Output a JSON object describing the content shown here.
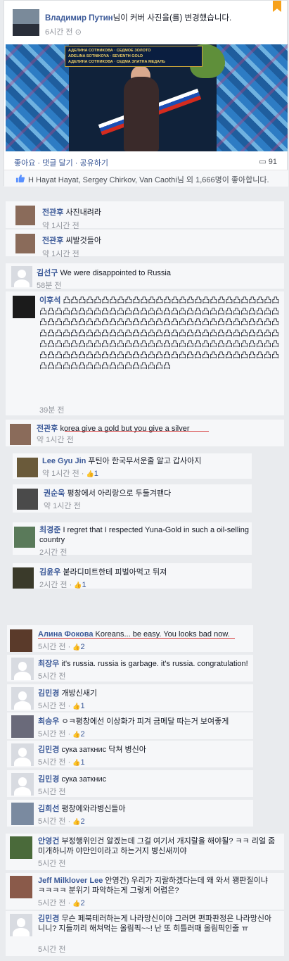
{
  "post": {
    "author": "Владимир Путин",
    "action_text": "님이 커버 사진을(를) 변경했습니다.",
    "time": "6시간 전",
    "photo_banner": [
      "АДЕЛИНА СОТНИКОВА · СЕДМОЕ ЗОЛОТО",
      "ADELINA SOTNIKOVA · SEVENTH GOLD",
      "АДЕЛИНА СОТНИКОВА · СЕДМА ЗЛАТНА МЕДАЛЬ"
    ],
    "actions": [
      "좋아요",
      "댓글 달기",
      "공유하기"
    ],
    "comment_count": "91",
    "likes_text": "H Hayat Hayat, Sergey Chirkov, Van Caothi님 외 1,666명이 좋아합니다."
  },
  "comments": [
    {
      "name": "전관후",
      "text": "사진내려라",
      "time": "약 1시간 전"
    },
    {
      "name": "전관후",
      "text": "씨발것들아",
      "time": "약 1시간 전"
    },
    {
      "name": "김선구",
      "text": "We were disappointed to Russia",
      "time": "58분 전"
    },
    {
      "name": "이후석",
      "text": "凸凸凸凸凸凸凸凸凸凸凸凸凸凸凸凸凸凸凸凸凸凸凸凸凸凸凸凸凸凸凸凸凸凸凸凸凸凸凸凸凸凸凸凸凸凸凸凸凸凸凸凸凸凸凸凸凸凸凸凸凸凸凸凸凸凸凸凸凸凸凸凸凸凸凸凸凸凸凸凸凸凸凸凸凸凸凸凸凸凸凸凸凸凸凸凸凸凸凸凸凸凸凸凸凸凸凸凸凸凸凸凸凸凸凸凸凸凸凸凸凸凸凸凸凸凸凸凸凸凸凸凸凸凸凸凸凸凸凸凸凸凸凸凸凸凸凸凸凸凸凸凸凸凸凸凸凸凸凸凸凸凸凸凸凸凸凸凸凸凸凸凸凸凸凸凸凸凸凸凸凸凸凸凸凸凸凸凸凸凸凸凸凸凸凸凸凸凸凸凸",
      "time": "39분 전"
    },
    {
      "name": "전관후",
      "text": "korea give a gold but you give a silver",
      "time": "약 1시간 전"
    },
    {
      "name": "Lee Gyu Jin",
      "text": "푸틴아 한국무서운줄 알고 갑사아지",
      "time": "약 1시간 전",
      "likes": "1"
    },
    {
      "name": "권순욱",
      "text": "평창에서 아리랑으로 두둘겨팬다",
      "time": "약 1시간 전"
    },
    {
      "name": "최경준",
      "text": "I regret that I respected Yuna-Gold in such a oil-selling country",
      "time": "2시간 전"
    },
    {
      "name": "김윤우",
      "text": "붙라디미트한테 피벌아먹고 뒤져",
      "time": "2시간 전",
      "likes": "1"
    },
    {
      "name": "Алина Фокова",
      "text": "Koreans... be easy. You looks bad now.",
      "time": "5시간 전",
      "likes": "2"
    },
    {
      "name": "최장우",
      "text": "it's russia. russia is garbage. it's russia. congratulation!",
      "time": "5시간 전"
    },
    {
      "name": "김민경",
      "text": "개방신새기",
      "time": "5시간 전",
      "likes": "1"
    },
    {
      "name": "최승우",
      "text": "ㅇㅋ평창에선 이상화가 피겨 금메달 따는거 보여좋게",
      "time": "5시간 전",
      "likes": "2"
    },
    {
      "name": "김민경",
      "text": "сука заткнис 닥쳐 병신아",
      "time": "5시간 전",
      "likes": "1"
    },
    {
      "name": "김민경",
      "text": "сука заткнис",
      "time": "5시간 전"
    },
    {
      "name": "김희선",
      "text": "평창에와라병신들아",
      "time": "5시간 전",
      "likes": "2"
    },
    {
      "name": "안영건",
      "text": "부정행위인건 알겠는데 그걸 여기서 개지랄을 해야될? ㅋㅋ 리얼 줌미개하니까 야만인이라고 하는거지 병신새끼야",
      "time": "5시간 전"
    },
    {
      "name": "Jeff Milklover Lee",
      "text": "안영건) 우리가 지랄하겠다는데 왜 와서 꽹판질이냐 ㅋㅋㅋㅋ 분위기 파악하는게 그렇게 어렵은?",
      "time": "5시간 전",
      "likes": "2"
    },
    {
      "name": "김민경",
      "text": "무슨 페북테러하는게 나라망신이야 그러면 편파판정은 나라망신아니니? 지들끼리 해쳐먹는 올림픽~~! 난 또 히틀러때 올림픽인줄 ㅠ",
      "time": "5시간 전"
    }
  ],
  "colors": {
    "link": "#3b5998",
    "muted": "#90949c",
    "underline": "#d63a3a"
  }
}
